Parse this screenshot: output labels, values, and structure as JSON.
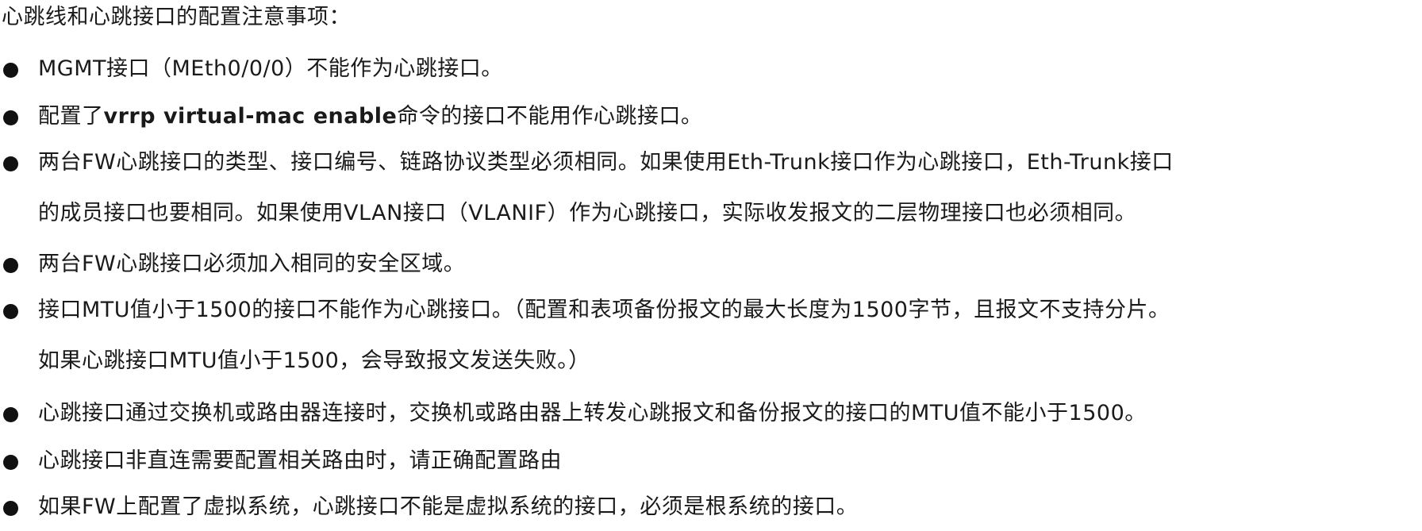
{
  "heading": "心跳线和心跳接口的配置注意事项：",
  "items": [
    {
      "text": "MGMT接口（MEth0/0/0）不能作为心跳接口。"
    },
    {
      "before": "配置了",
      "bold": "vrrp virtual-mac enable",
      "after": "命令的接口不能用作心跳接口。"
    },
    {
      "line1": "两台FW心跳接口的类型、接口编号、链路协议类型必须相同。如果使用Eth-Trunk接口作为心跳接口，Eth-Trunk接口",
      "line2": "的成员接口也要相同。如果使用VLAN接口（VLANIF）作为心跳接口，实际收发报文的二层物理接口也必须相同。"
    },
    {
      "text": "两台FW心跳接口必须加入相同的安全区域。"
    },
    {
      "line1": "接口MTU值小于1500的接口不能作为心跳接口。（配置和表项备份报文的最大长度为1500字节，且报文不支持分片。",
      "line2": "如果心跳接口MTU值小于1500，会导致报文发送失败。）"
    },
    {
      "text": "心跳接口通过交换机或路由器连接时，交换机或路由器上转发心跳报文和备份报文的接口的MTU值不能小于1500。"
    },
    {
      "text": "心跳接口非直连需要配置相关路由时，请正确配置路由"
    },
    {
      "text": "如果FW上配置了虚拟系统，心跳接口不能是虚拟系统的接口，必须是根系统的接口。"
    }
  ]
}
